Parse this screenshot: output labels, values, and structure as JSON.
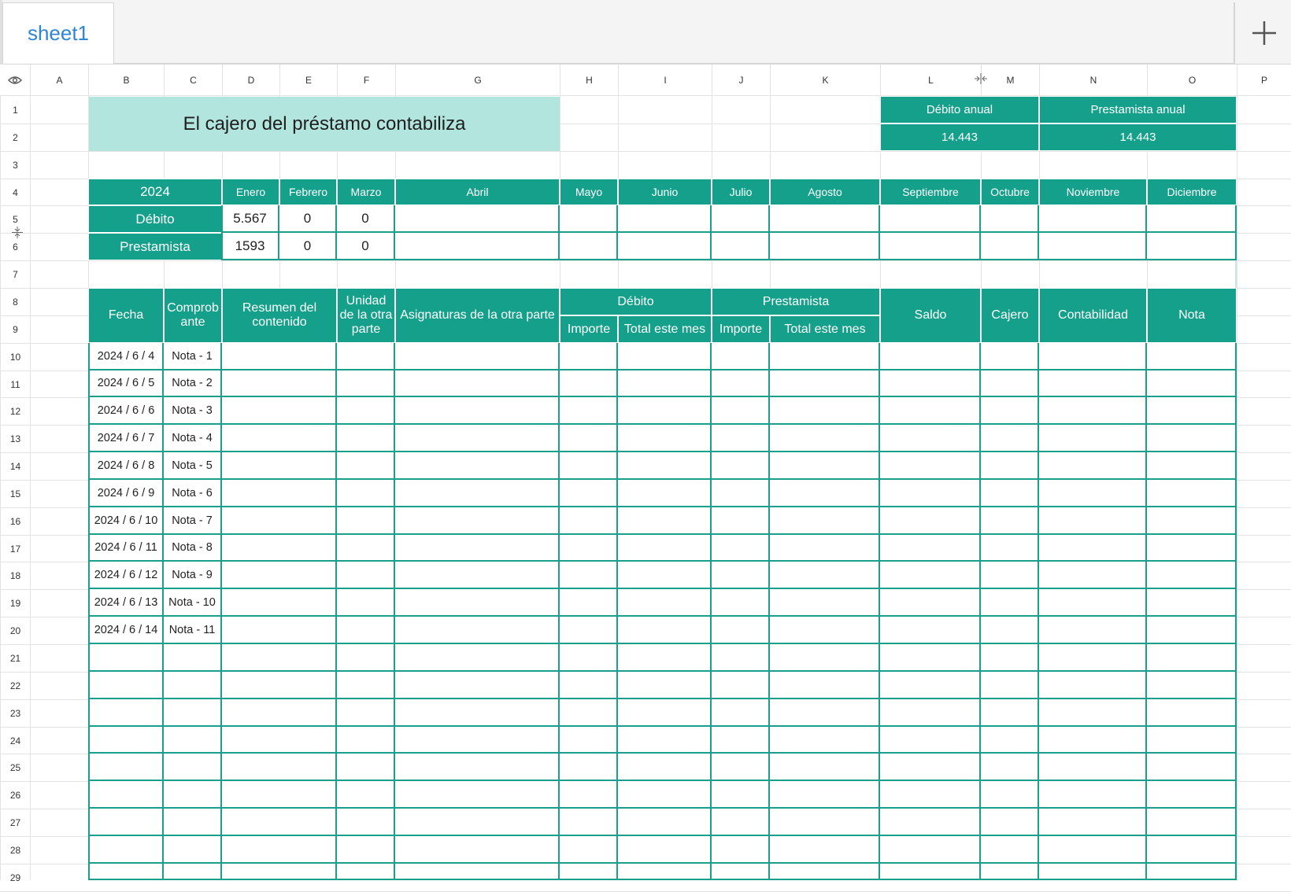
{
  "tabs": {
    "sheet_name": "sheet1"
  },
  "columns": [
    "A",
    "B",
    "C",
    "D",
    "E",
    "F",
    "G",
    "H",
    "I",
    "J",
    "K",
    "L",
    "M",
    "N",
    "O",
    "P"
  ],
  "rows": [
    "1",
    "2",
    "3",
    "4",
    "5",
    "6",
    "7",
    "8",
    "9",
    "10",
    "11",
    "12",
    "13",
    "14",
    "15",
    "16",
    "17",
    "18",
    "19",
    "20",
    "21",
    "22",
    "23",
    "24",
    "25",
    "26",
    "27",
    "28",
    "29"
  ],
  "sheet": {
    "title": "El cajero del préstamo contabiliza",
    "annual_debit_label": "Débito anual",
    "annual_debit_value": "14.443",
    "annual_lender_label": "Prestamista anual",
    "annual_lender_value": "14.443",
    "year": "2024",
    "months": [
      "Enero",
      "Febrero",
      "Marzo",
      "Abril",
      "Mayo",
      "Junio",
      "Julio",
      "Agosto",
      "Septiembre",
      "Octubre",
      "Noviembre",
      "Diciembre"
    ],
    "debit_label": "Débito",
    "lender_label": "Prestamista",
    "debit_values": [
      "5.567",
      "0",
      "0",
      "",
      "",
      "",
      "",
      "",
      "",
      "",
      "",
      ""
    ],
    "lender_values": [
      "1593",
      "0",
      "0",
      "",
      "",
      "",
      "",
      "",
      "",
      "",
      "",
      ""
    ],
    "ledger_headers": {
      "fecha": "Fecha",
      "comprobante": "Comprob ante",
      "resumen": "Resumen del contenido",
      "unidad": "Unidad de la otra parte",
      "asignaturas": "Asignaturas de la otra parte",
      "debito": "Débito",
      "prestamista": "Prestamista",
      "importe": "Importe",
      "total_mes": "Total este mes",
      "saldo": "Saldo",
      "cajero": "Cajero",
      "contabilidad": "Contabilidad",
      "nota": "Nota"
    },
    "entries": [
      {
        "fecha": "2024 / 6 / 4",
        "comprobante": "Nota - 1"
      },
      {
        "fecha": "2024 / 6 / 5",
        "comprobante": "Nota - 2"
      },
      {
        "fecha": "2024 / 6 / 6",
        "comprobante": "Nota - 3"
      },
      {
        "fecha": "2024 / 6 / 7",
        "comprobante": "Nota - 4"
      },
      {
        "fecha": "2024 / 6 / 8",
        "comprobante": "Nota - 5"
      },
      {
        "fecha": "2024 / 6 / 9",
        "comprobante": "Nota - 6"
      },
      {
        "fecha": "2024 / 6 / 10",
        "comprobante": "Nota - 7"
      },
      {
        "fecha": "2024 / 6 / 11",
        "comprobante": "Nota - 8"
      },
      {
        "fecha": "2024 / 6 / 12",
        "comprobante": "Nota - 9"
      },
      {
        "fecha": "2024 / 6 / 13",
        "comprobante": "Nota - 10"
      },
      {
        "fecha": "2024 / 6 / 14",
        "comprobante": "Nota - 11"
      }
    ]
  },
  "colors": {
    "accent": "#14a08a",
    "title_fill": "#b3e5df",
    "tab_text": "#2f86d6"
  },
  "icons": {
    "visibility": "eye-icon",
    "add_sheet": "plus-icon",
    "column_resize": "column-resize-icon",
    "row_resize": "row-resize-icon"
  }
}
